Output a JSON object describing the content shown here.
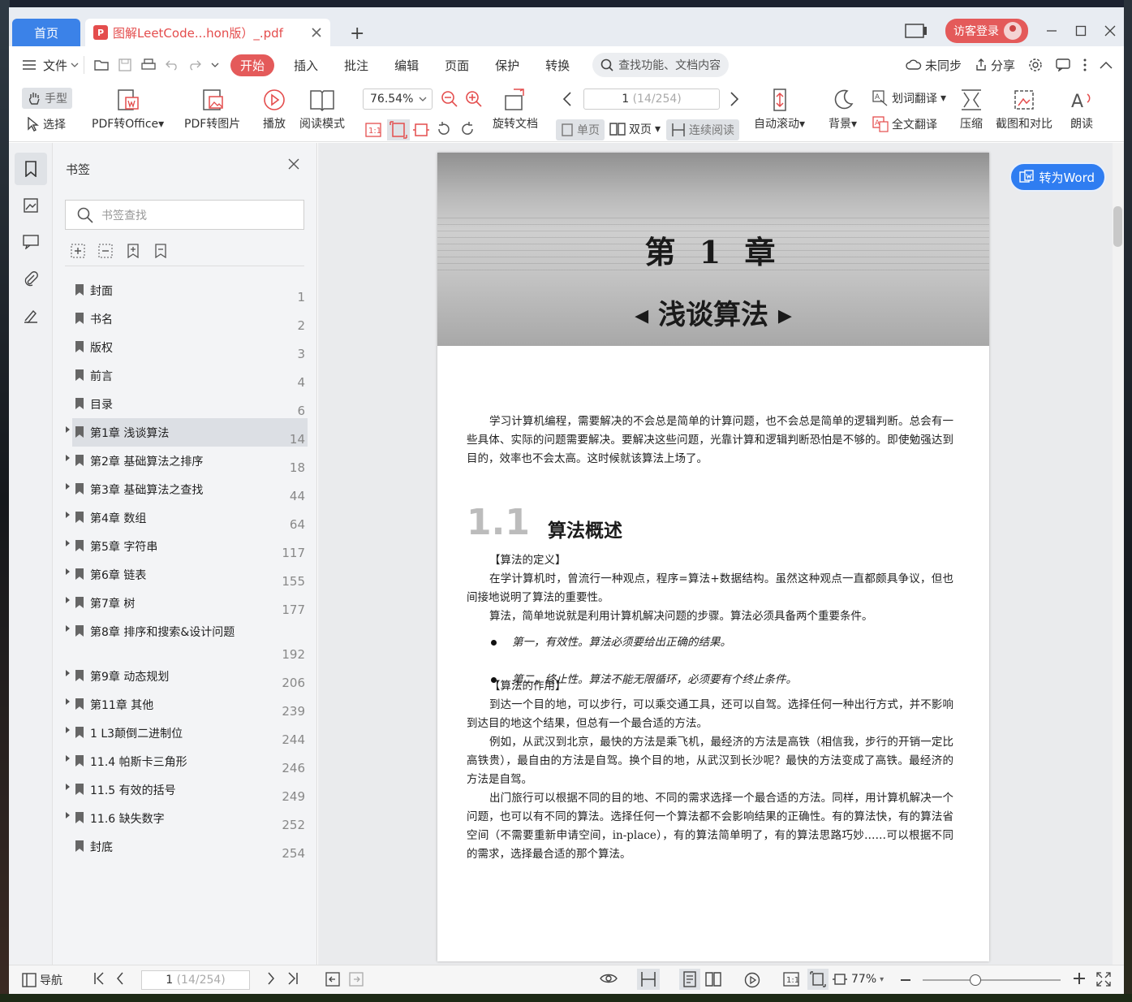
{
  "tabs": {
    "home": "首页",
    "doc": "图解LeetCode...hon版）_.pdf",
    "new_tab": "+"
  },
  "titlebar": {
    "page_badge": "1",
    "login": "访客登录"
  },
  "menu": {
    "file": "文件",
    "items": [
      "开始",
      "插入",
      "批注",
      "编辑",
      "页面",
      "保护",
      "转换"
    ],
    "search_placeholder": "查找功能、文档内容",
    "sync": "未同步",
    "share": "分享"
  },
  "toolbar": {
    "hand": "手型",
    "select": "选择",
    "pdf_to_office": "PDF转Office",
    "pdf_to_image": "PDF转图片",
    "play": "播放",
    "read_mode": "阅读模式",
    "zoom": "76.54%",
    "page_current": "1",
    "page_total": "(14/254)",
    "rotate_doc": "旋转文档",
    "single_page": "单页",
    "double_page": "双页",
    "continuous": "连续阅读",
    "auto_scroll": "自动滚动",
    "background": "背景",
    "word_translate": "划词翻译",
    "full_translate": "全文翻译",
    "compress": "压缩",
    "screenshot_compare": "截图和对比",
    "read_aloud": "朗读"
  },
  "bookmarks": {
    "title": "书签",
    "search_placeholder": "书签查找",
    "items": [
      {
        "label": "封面",
        "page": "1",
        "expandable": false
      },
      {
        "label": "书名",
        "page": "2",
        "expandable": false
      },
      {
        "label": "版权",
        "page": "3",
        "expandable": false
      },
      {
        "label": "前言",
        "page": "4",
        "expandable": false
      },
      {
        "label": "目录",
        "page": "6",
        "expandable": false
      },
      {
        "label": "第1章 浅谈算法",
        "page": "14",
        "expandable": true,
        "selected": true
      },
      {
        "label": "第2章 基础算法之排序",
        "page": "18",
        "expandable": true
      },
      {
        "label": "第3章 基础算法之查找",
        "page": "44",
        "expandable": true
      },
      {
        "label": "第4章 数组",
        "page": "64",
        "expandable": true
      },
      {
        "label": "第5章 字符串",
        "page": "117",
        "expandable": true
      },
      {
        "label": "第6章 链表",
        "page": "155",
        "expandable": true
      },
      {
        "label": "第7章 树",
        "page": "177",
        "expandable": true
      },
      {
        "label": "第8章 排序和搜索&设计问题",
        "page": "192",
        "expandable": true,
        "tall": true
      },
      {
        "label": "第9章 动态规划",
        "page": "206",
        "expandable": true
      },
      {
        "label": "第11章 其他",
        "page": "239",
        "expandable": true
      },
      {
        "label": "1 L3颠倒二进制位",
        "page": "244",
        "expandable": true
      },
      {
        "label": "11.4 帕斯卡三角形",
        "page": "246",
        "expandable": true
      },
      {
        "label": "11.5 有效的括号",
        "page": "249",
        "expandable": true
      },
      {
        "label": "11.6 缺失数字",
        "page": "252",
        "expandable": true
      },
      {
        "label": "封底",
        "page": "254",
        "expandable": false
      }
    ]
  },
  "document": {
    "chapter": "第 1 章",
    "chapter_title": "◂ 浅谈算法 ▸",
    "intro": "学习计算机编程，需要解决的不会总是简单的计算问题，也不会总是简单的逻辑判断。总会有一些具体、实际的问题需要解决。要解决这些问题，光靠计算和逻辑判断恐怕是不够的。即使勉强达到目的，效率也不会太高。这时候就该算法上场了。",
    "section_num": "1.1",
    "section_title": "算法概述",
    "def_head": "【算法的定义】",
    "def_p1": "在学计算机时，曾流行一种观点，程序=算法+数据结构。虽然这种观点一直都颇具争议，但也间接地说明了算法的重要性。",
    "def_p2": "算法，简单地说就是利用计算机解决问题的步骤。算法必须具备两个重要条件。",
    "bullet1": "第一，有效性。算法必须要给出正确的结果。",
    "bullet2": "第二，终止性。算法不能无限循环，必须要有个终止条件。",
    "use_head": "【算法的作用】",
    "use_p1": "到达一个目的地，可以步行，可以乘交通工具，还可以自驾。选择任何一种出行方式，并不影响到达目的地这个结果，但总有一个最合适的方法。",
    "use_p2": "例如，从武汉到北京，最快的方法是乘飞机，最经济的方法是高铁（相信我，步行的开销一定比高铁贵），最自由的方法是自驾。换个目的地，从武汉到长沙呢？最快的方法变成了高铁。最经济的方法是自驾。",
    "use_p3": "出门旅行可以根据不同的目的地、不同的需求选择一个最合适的方法。同样，用计算机解决一个问题，也可以有不同的算法。选择任何一个算法都不会影响结果的正确性。有的算法快，有的算法省空间（不需要重新申请空间，in-place），有的算法简单明了，有的算法思路巧妙……可以根据不同的需求，选择最合适的那个算法。",
    "to_word": "转为Word"
  },
  "statusbar": {
    "nav": "导航",
    "page_current": "1",
    "page_total": "(14/254)",
    "zoom": "77%",
    "zoom_level": 0.38
  },
  "colors": {
    "accent": "#3b82e8",
    "brand_red": "#e45a5a"
  }
}
